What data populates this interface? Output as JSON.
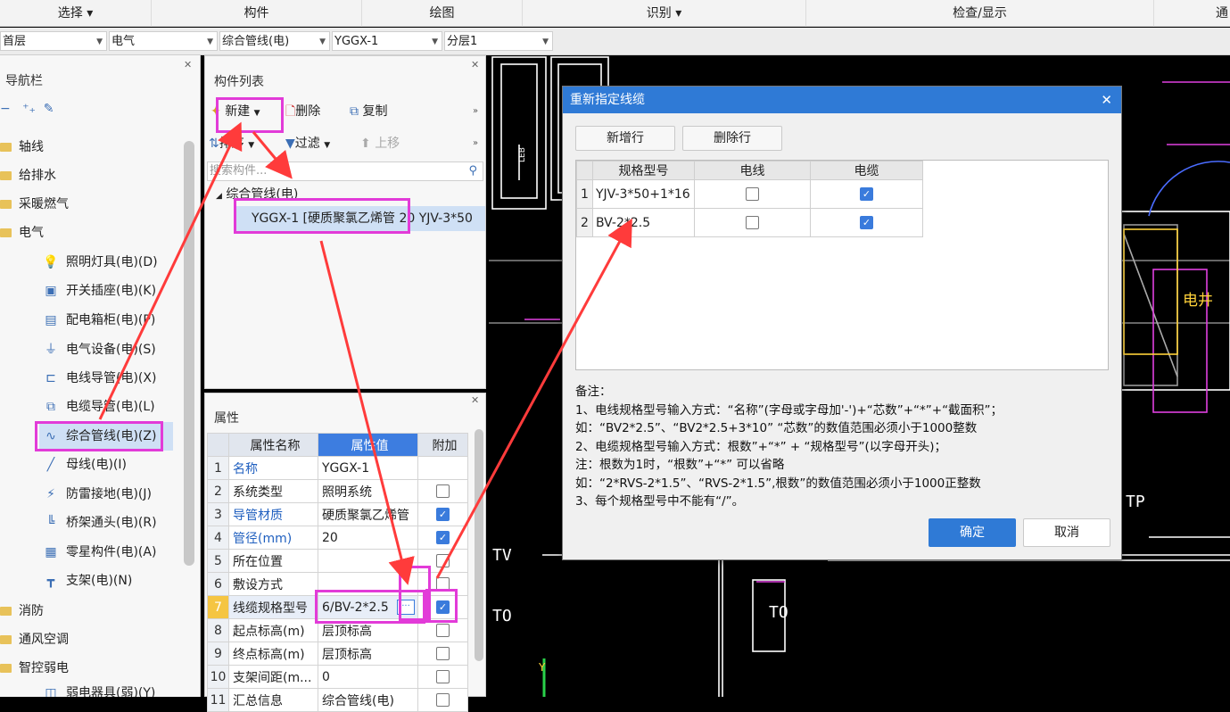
{
  "menu": {
    "items": [
      "选择 ▾",
      "构件",
      "绘图",
      "识别 ▾",
      "检查/显示",
      "通"
    ]
  },
  "context": {
    "floor": "首层",
    "category": "电气",
    "type": "综合管线(电)",
    "item": "YGGX-1",
    "layer": "分层1"
  },
  "nav": {
    "title": "导航栏",
    "groups": [
      {
        "label": "轴线"
      },
      {
        "label": "给排水"
      },
      {
        "label": "采暖燃气"
      },
      {
        "label": "电气"
      }
    ],
    "items": [
      {
        "label": "照明灯具(电)(D)",
        "icon": "bulb-icon"
      },
      {
        "label": "开关插座(电)(K)",
        "icon": "switch-icon"
      },
      {
        "label": "配电箱柜(电)(P)",
        "icon": "panel-icon"
      },
      {
        "label": "电气设备(电)(S)",
        "icon": "equipment-icon"
      },
      {
        "label": "电线导管(电)(X)",
        "icon": "conduit-icon"
      },
      {
        "label": "电缆导管(电)(L)",
        "icon": "cable-conduit-icon"
      },
      {
        "label": "综合管线(电)(Z)",
        "icon": "combined-line-icon"
      },
      {
        "label": "母线(电)(I)",
        "icon": "busbar-icon"
      },
      {
        "label": "防雷接地(电)(J)",
        "icon": "lightning-icon"
      },
      {
        "label": "桥架通头(电)(R)",
        "icon": "tray-icon"
      },
      {
        "label": "零星构件(电)(A)",
        "icon": "misc-icon"
      },
      {
        "label": "支架(电)(N)",
        "icon": "bracket-icon"
      }
    ],
    "groups2": [
      {
        "label": "消防"
      },
      {
        "label": "通风空调"
      },
      {
        "label": "智控弱电"
      }
    ],
    "last_item": "弱电器具(弱)(Y)"
  },
  "complist": {
    "title": "构件列表",
    "new": "新建",
    "delete": "删除",
    "copy": "复制",
    "sort": "排序",
    "filter": "过滤",
    "moveup": "上移",
    "search_placeholder": "搜索构件...",
    "tree_root": "综合管线(电)",
    "tree_item": "YGGX-1 [硬质聚氯乙烯管 20 YJV-3*50"
  },
  "props": {
    "title": "属性",
    "headers": [
      "属性名称",
      "属性值",
      "附加"
    ],
    "rows": [
      {
        "n": "1",
        "name": "名称",
        "value": "YGGX-1",
        "blue": true,
        "cb": "none"
      },
      {
        "n": "2",
        "name": "系统类型",
        "value": "照明系统",
        "blue": false,
        "cb": "off"
      },
      {
        "n": "3",
        "name": "导管材质",
        "value": "硬质聚氯乙烯管",
        "blue": true,
        "cb": "on"
      },
      {
        "n": "4",
        "name": "管径(mm)",
        "value": "20",
        "blue": true,
        "cb": "on"
      },
      {
        "n": "5",
        "name": "所在位置",
        "value": "",
        "blue": false,
        "cb": "off"
      },
      {
        "n": "6",
        "name": "敷设方式",
        "value": "",
        "blue": false,
        "cb": "off"
      },
      {
        "n": "7",
        "name": "线缆规格型号",
        "value": "6/BV-2*2.5",
        "blue": false,
        "cb": "on"
      },
      {
        "n": "8",
        "name": "起点标高(m)",
        "value": "层顶标高",
        "blue": false,
        "cb": "off"
      },
      {
        "n": "9",
        "name": "终点标高(m)",
        "value": "层顶标高",
        "blue": false,
        "cb": "off"
      },
      {
        "n": "10",
        "name": "支架间距(m...",
        "value": "0",
        "blue": false,
        "cb": "off"
      },
      {
        "n": "11",
        "name": "汇总信息",
        "value": "综合管线(电)",
        "blue": false,
        "cb": "off"
      }
    ]
  },
  "dialog": {
    "title": "重新指定线缆",
    "add_row": "新增行",
    "del_row": "删除行",
    "headers": [
      "规格型号",
      "电线",
      "电缆"
    ],
    "rows": [
      {
        "n": "1",
        "spec": "YJV-3*50+1*16",
        "wire": false,
        "cable": true
      },
      {
        "n": "2",
        "spec": "BV-2*2.5",
        "wire": false,
        "cable": true
      }
    ],
    "notes": [
      "备注：",
      "1、电线规格型号输入方式：“名称”(字母或字母加'-')+“芯数”+“*”+“截面积”；",
      "如：“BV2*2.5”、“BV2*2.5+3*10” “芯数”的数值范围必须小于1000整数",
      "2、电缆规格型号输入方式：根数”+“*” + “规格型号”(以字母开头)；",
      "注：根数为1时，“根数”+“*” 可以省略",
      "如：“2*RVS-2*1.5”、“RVS-2*1.5”,根数”的数值范围必须小于1000正整数",
      "3、每个规格型号中不能有“/”。"
    ],
    "ok": "确定",
    "cancel": "取消"
  },
  "cad": {
    "labels": [
      "TV",
      "TO",
      "TO",
      "TP",
      "电井",
      "LEB",
      "Y"
    ]
  },
  "colors": {
    "accent": "#2f7ad6",
    "highlight": "#e23bd8",
    "arrow": "#ff3b3b"
  }
}
